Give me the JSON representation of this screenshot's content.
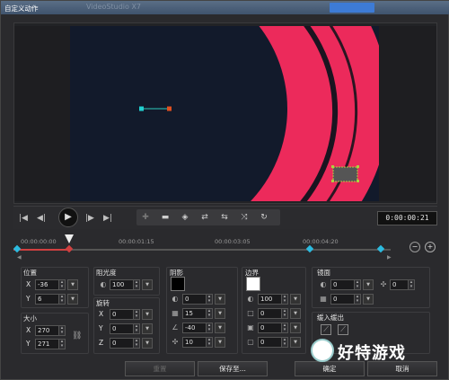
{
  "window": {
    "title": "自定义动作",
    "ghost_title": "VideoStudio X7"
  },
  "transport": {
    "timecode": "0:00:00:21",
    "buttons": [
      "home-icon",
      "prev-frame-icon",
      "play-icon",
      "next-frame-icon",
      "end-icon"
    ],
    "keyframe_tools": [
      "add-keyframe-icon",
      "remove-keyframe-icon",
      "reverse-icon",
      "move-left-icon",
      "move-right-icon",
      "fit-icon",
      "goto-icon"
    ]
  },
  "timeline": {
    "labels": [
      "00:00:00:00",
      "00:00:01:15",
      "00:00:03:05",
      "00:00:04:20"
    ]
  },
  "position": {
    "title": "位置",
    "x_label": "X",
    "x_value": "-36",
    "y_label": "Y",
    "y_value": "6"
  },
  "size": {
    "title": "大小",
    "x_label": "X",
    "x_value": "270",
    "y_label": "Y",
    "y_value": "271"
  },
  "opacity": {
    "title": "阻光度",
    "value": "100"
  },
  "rotation": {
    "title": "旋转",
    "x_label": "X",
    "x_value": "0",
    "y_label": "Y",
    "y_value": "0",
    "z_label": "Z",
    "z_value": "0"
  },
  "shadow": {
    "title": "阴影",
    "color": "#000000",
    "v1": "0",
    "v2": "15",
    "v3": "-40",
    "v4": "10"
  },
  "border": {
    "title": "边界",
    "color": "#ffffff",
    "v1": "100",
    "v2": "0",
    "v3": "0",
    "v4": "0"
  },
  "mirror": {
    "title": "镜面",
    "v1": "0",
    "v2": "0",
    "v3": "0"
  },
  "easing": {
    "title": "缓入缓出"
  },
  "buttons": {
    "reset": "重置",
    "save_to": "保存至...",
    "ok": "确定",
    "cancel": "取消"
  },
  "watermark": {
    "text": "好特游戏"
  },
  "colors": {
    "accent_pink": "#ec2a5b",
    "canvas_bg": "#121a2b",
    "keyframe": "#2bbbe0"
  }
}
